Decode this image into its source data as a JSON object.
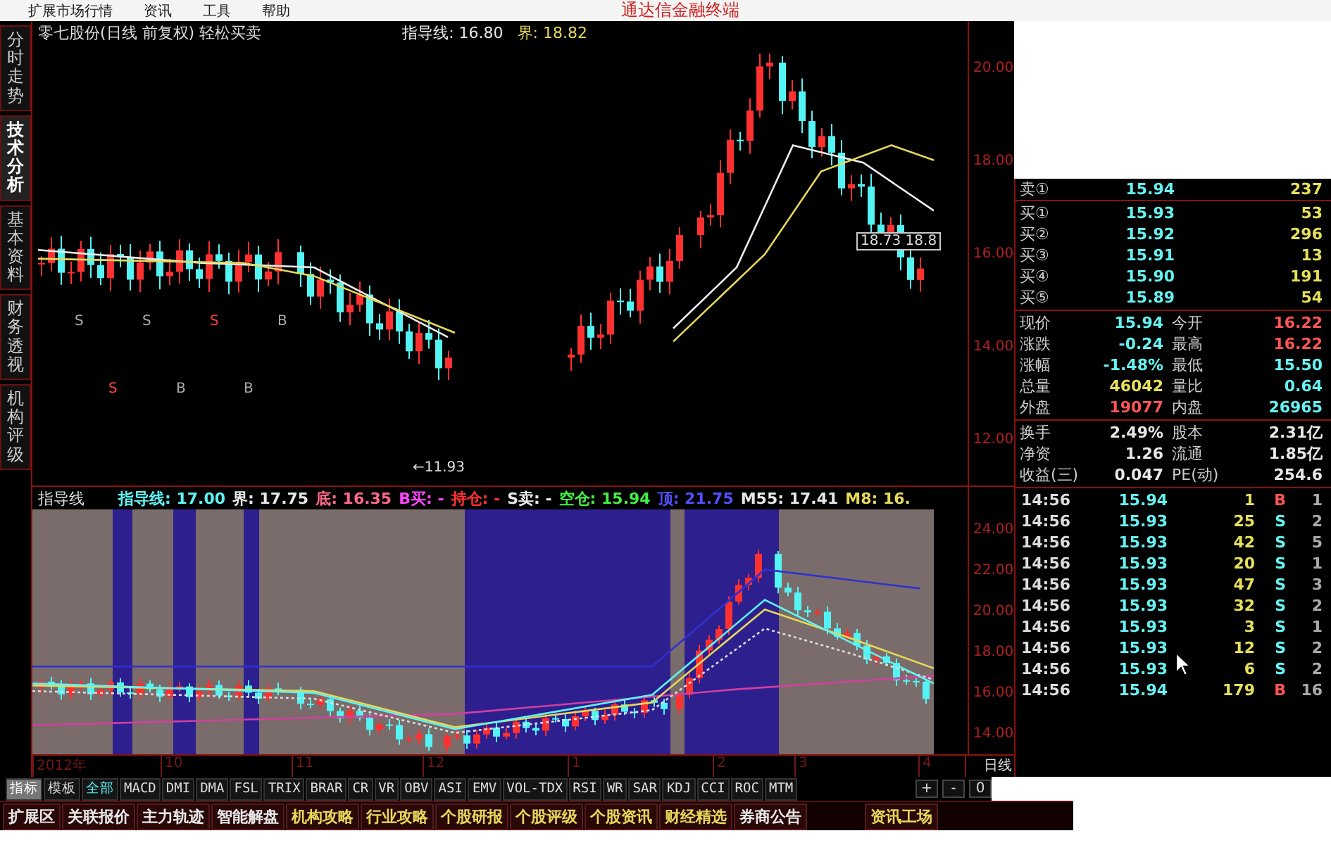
{
  "menu": {
    "items": [
      "扩展市场行情",
      "资讯",
      "工具",
      "帮助"
    ],
    "title": "通达信金融终端"
  },
  "side_tabs": [
    {
      "label": "分时走势",
      "selected": false
    },
    {
      "label": "技术分析",
      "selected": true
    },
    {
      "label": "基本资料",
      "selected": false
    },
    {
      "label": "财务透视",
      "selected": false
    },
    {
      "label": "机构评级",
      "selected": false
    }
  ],
  "upper_chart": {
    "title": "零七股份(日线 前复权) 轻松买卖",
    "readouts": [
      {
        "text": "指导线: 16.80",
        "color": "#e8e8e8"
      },
      {
        "text": "界: 18.82",
        "color": "#e6d85a"
      }
    ],
    "axis": [
      "20.00",
      "18.00",
      "16.00",
      "14.00",
      "12.00"
    ],
    "low_marker": "←11.93",
    "price_box": "18.73 18.8",
    "signals": [
      "S",
      "S",
      "S",
      "B",
      "S",
      "B",
      "B"
    ]
  },
  "lower_chart": {
    "name": "指导线",
    "readouts": [
      {
        "text": "指导线: 17.00",
        "kind": "guide"
      },
      {
        "text": "界: 17.75",
        "kind": "plain"
      },
      {
        "text": "底: 16.35",
        "kind": "floor"
      },
      {
        "text": "B买: -",
        "kind": "buy"
      },
      {
        "text": "持仓: -",
        "kind": "hold"
      },
      {
        "text": "S卖: -",
        "kind": "plain"
      },
      {
        "text": "空仓: 15.94",
        "kind": "cash"
      },
      {
        "text": "顶: 21.75",
        "kind": "top"
      },
      {
        "text": "M55: 17.41",
        "kind": "plain"
      },
      {
        "text": "M8: 16.",
        "kind": "average"
      }
    ],
    "axis": [
      "24.00",
      "22.00",
      "20.00",
      "18.00",
      "16.00",
      "14.00"
    ]
  },
  "time_axis": {
    "labels": [
      "2012年",
      "10",
      "11",
      "12",
      "1",
      "2",
      "3",
      "4"
    ],
    "period": "日线"
  },
  "indicator_tabs": [
    {
      "label": "指标",
      "selected": true
    },
    {
      "label": "模板",
      "selected": false
    },
    {
      "label": "全部",
      "selected": true
    },
    {
      "label": "MACD",
      "selected": false
    },
    {
      "label": "DMI",
      "selected": false
    },
    {
      "label": "DMA",
      "selected": false
    },
    {
      "label": "FSL",
      "selected": false
    },
    {
      "label": "TRIX",
      "selected": false
    },
    {
      "label": "BRAR",
      "selected": false
    },
    {
      "label": "CR",
      "selected": false
    },
    {
      "label": "VR",
      "selected": false
    },
    {
      "label": "OBV",
      "selected": false
    },
    {
      "label": "ASI",
      "selected": false
    },
    {
      "label": "EMV",
      "selected": false
    },
    {
      "label": "VOL-TDX",
      "selected": false
    },
    {
      "label": "RSI",
      "selected": false
    },
    {
      "label": "WR",
      "selected": false
    },
    {
      "label": "SAR",
      "selected": false
    },
    {
      "label": "KDJ",
      "selected": false
    },
    {
      "label": "CCI",
      "selected": false
    },
    {
      "label": "ROC",
      "selected": false
    },
    {
      "label": "MTM",
      "selected": false
    }
  ],
  "zoom_buttons": [
    "+",
    "-",
    "0"
  ],
  "bottom_tabs": [
    {
      "label": "扩展区",
      "kind": "system"
    },
    {
      "label": "关联报价",
      "kind": "system"
    },
    {
      "label": "主力轨迹",
      "kind": "system"
    },
    {
      "label": "智能解盘",
      "kind": "system"
    },
    {
      "label": "机构攻略",
      "kind": "info"
    },
    {
      "label": "行业攻略",
      "kind": "info"
    },
    {
      "label": "个股研报",
      "kind": "info"
    },
    {
      "label": "个股评级",
      "kind": "info"
    },
    {
      "label": "个股资讯",
      "kind": "info"
    },
    {
      "label": "财经精选",
      "kind": "info"
    },
    {
      "label": "券商公告",
      "kind": "system"
    },
    {
      "label": "资讯工场",
      "kind": "info"
    }
  ],
  "quote": {
    "ask": {
      "label": "卖①",
      "price": "15.94",
      "volume": "237"
    },
    "bids": [
      {
        "label": "买①",
        "price": "15.93",
        "volume": "53"
      },
      {
        "label": "买②",
        "price": "15.92",
        "volume": "296"
      },
      {
        "label": "买③",
        "price": "15.91",
        "volume": "13"
      },
      {
        "label": "买④",
        "price": "15.90",
        "volume": "191"
      },
      {
        "label": "买⑤",
        "price": "15.89",
        "volume": "54"
      }
    ],
    "stats": [
      {
        "cells": [
          {
            "label": "现价",
            "value": "15.94",
            "color": "#66f2f2"
          },
          {
            "label": "今开",
            "value": "16.22",
            "color": "#ff5555"
          }
        ]
      },
      {
        "cells": [
          {
            "label": "涨跌",
            "value": "-0.24",
            "color": "#66f2f2"
          },
          {
            "label": "最高",
            "value": "16.22",
            "color": "#ff5555"
          }
        ]
      },
      {
        "cells": [
          {
            "label": "涨幅",
            "value": "-1.48%",
            "color": "#66f2f2"
          },
          {
            "label": "最低",
            "value": "15.50",
            "color": "#66f2f2"
          }
        ]
      },
      {
        "cells": [
          {
            "label": "总量",
            "value": "46042",
            "color": "#e6e05a"
          },
          {
            "label": "量比",
            "value": "0.64",
            "color": "#66f2f2"
          }
        ]
      },
      {
        "cells": [
          {
            "label": "外盘",
            "value": "19077",
            "color": "#ff5555"
          },
          {
            "label": "内盘",
            "value": "26965",
            "color": "#66f2f2"
          }
        ]
      }
    ],
    "finance": [
      {
        "cells": [
          {
            "label": "换手",
            "value": "2.49%",
            "color": "#e8e8e8"
          },
          {
            "label": "股本",
            "value": "2.31亿",
            "color": "#e8e8e8"
          }
        ]
      },
      {
        "cells": [
          {
            "label": "净资",
            "value": "1.26",
            "color": "#e8e8e8"
          },
          {
            "label": "流通",
            "value": "1.85亿",
            "color": "#e8e8e8"
          }
        ]
      },
      {
        "cells": [
          {
            "label": "收益(三)",
            "value": "0.047",
            "color": "#e8e8e8"
          },
          {
            "label": "PE(动)",
            "value": "254.6",
            "color": "#e8e8e8"
          }
        ]
      }
    ],
    "ticks": [
      {
        "time": "14:56",
        "price": "15.94",
        "volume": "1",
        "side": "B",
        "kind": "buy",
        "count": "1"
      },
      {
        "time": "14:56",
        "price": "15.93",
        "volume": "25",
        "side": "S",
        "kind": "sell",
        "count": "2"
      },
      {
        "time": "14:56",
        "price": "15.93",
        "volume": "42",
        "side": "S",
        "kind": "sell",
        "count": "5"
      },
      {
        "time": "14:56",
        "price": "15.93",
        "volume": "20",
        "side": "S",
        "kind": "sell",
        "count": "1"
      },
      {
        "time": "14:56",
        "price": "15.93",
        "volume": "47",
        "side": "S",
        "kind": "sell",
        "count": "3"
      },
      {
        "time": "14:56",
        "price": "15.93",
        "volume": "32",
        "side": "S",
        "kind": "sell",
        "count": "2"
      },
      {
        "time": "14:56",
        "price": "15.93",
        "volume": "3",
        "side": "S",
        "kind": "sell",
        "count": "1"
      },
      {
        "time": "14:56",
        "price": "15.93",
        "volume": "12",
        "side": "S",
        "kind": "sell",
        "count": "2"
      },
      {
        "time": "14:56",
        "price": "15.93",
        "volume": "6",
        "side": "S",
        "kind": "sell",
        "count": "2"
      },
      {
        "time": "14:56",
        "price": "15.94",
        "volume": "179",
        "side": "B",
        "kind": "buy",
        "count": "16"
      }
    ]
  }
}
